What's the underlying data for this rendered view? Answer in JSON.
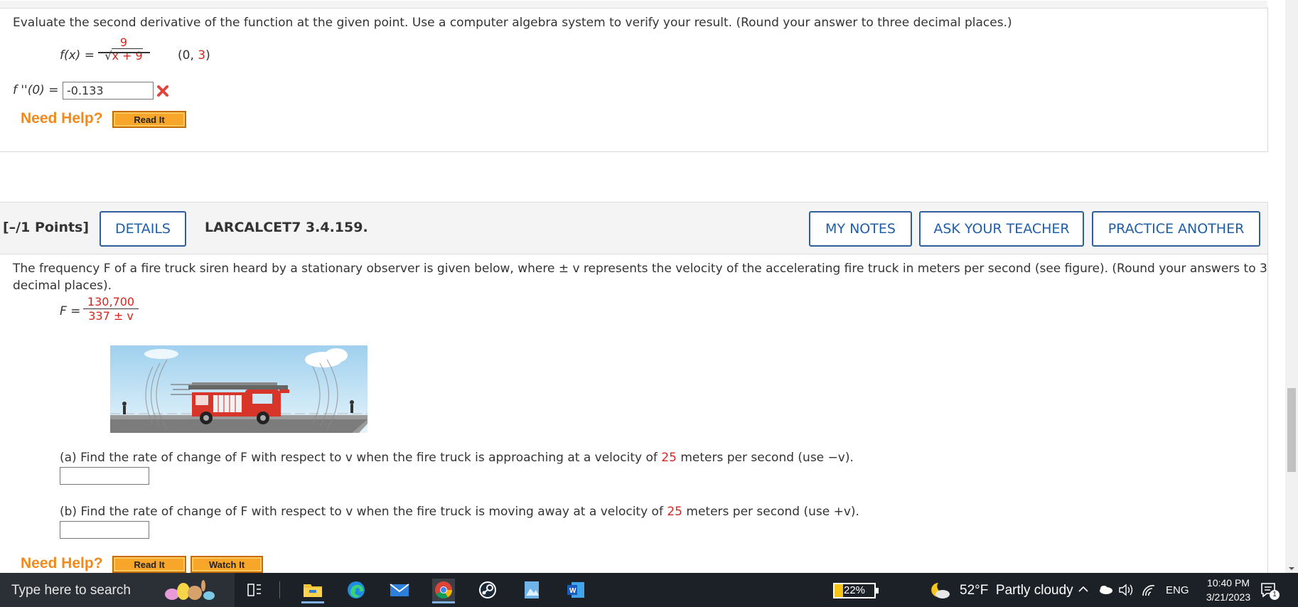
{
  "q1": {
    "instructions": "Evaluate the second derivative of the function at the given point. Use a computer algebra system to verify your result. (Round your answer to three decimal places.)",
    "fx_label": "f(x) =",
    "numerator": "9",
    "denominator": "x + 9",
    "point_open": "(0, ",
    "point_y": "3",
    "point_close": ")",
    "answer_label": "f ''(0) =",
    "answer_value": "-0.133",
    "status": "incorrect",
    "need_help": "Need Help?",
    "read_it": "Read It"
  },
  "q2": {
    "points": "[–/1 Points]",
    "details": "DETAILS",
    "problem_id": "LARCALCET7 3.4.159.",
    "my_notes": "MY NOTES",
    "ask_teacher": "ASK YOUR TEACHER",
    "practice_another": "PRACTICE ANOTHER",
    "intro_line1": "The frequency F of a fire truck siren heard by a stationary observer is given below, where ± v represents the velocity of the accelerating fire truck in meters per second (see figure). (Round your answers to 3",
    "intro_line2": "decimal places).",
    "F_label": "F =",
    "F_num": "130,700",
    "F_den": "337 ± v",
    "part_a_pre": "(a) Find the rate of change of F with respect to v when the fire truck is approaching at a velocity of ",
    "part_a_val": "25",
    "part_a_post": " meters per second (use −v).",
    "part_b_pre": "(b) Find the rate of change of F with respect to v when the fire truck is moving away at a velocity of ",
    "part_b_val": "25",
    "part_b_post": " meters per second (use +v).",
    "need_help": "Need Help?",
    "read_it": "Read It",
    "watch_it": "Watch It"
  },
  "taskbar": {
    "search_placeholder": "Type here to search",
    "battery": "22%",
    "weather": "52°F  Partly cloudy",
    "language": "ENG",
    "time": "10:40 PM",
    "date": "3/21/2023",
    "notification_count": "1"
  },
  "colors": {
    "accent": "#1f5ea8",
    "red": "#d7261e",
    "orange": "#f08a1c"
  },
  "icons": [
    "search-icon",
    "task-view-icon",
    "file-explorer-icon",
    "edge-icon",
    "mail-icon",
    "chrome-icon",
    "steam-icon",
    "photos-icon",
    "word-icon",
    "weather-icon",
    "chevron-up-icon",
    "cloud-icon",
    "speaker-icon",
    "wifi-icon",
    "notification-icon"
  ]
}
